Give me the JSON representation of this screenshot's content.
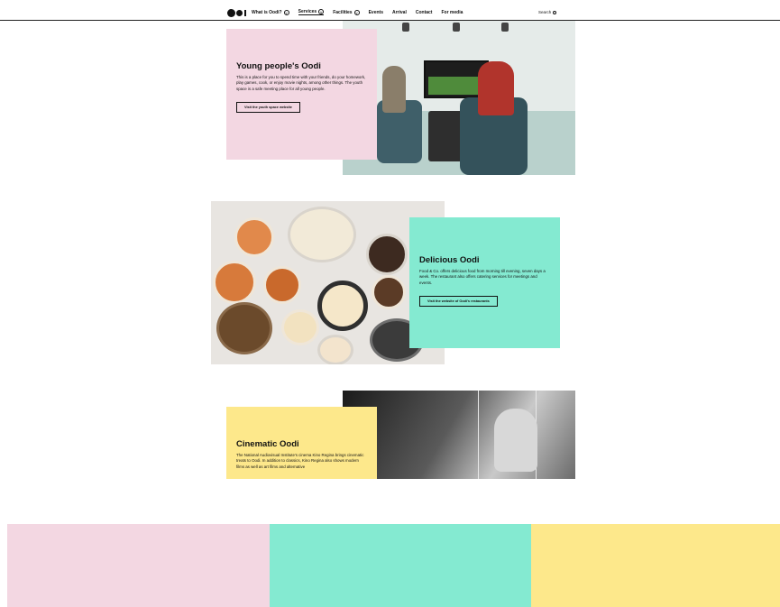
{
  "nav": {
    "items": [
      {
        "label": "What is Oodi?",
        "chevron": true,
        "active": false
      },
      {
        "label": "Services",
        "chevron": true,
        "active": true
      },
      {
        "label": "Facilities",
        "chevron": true,
        "active": false
      },
      {
        "label": "Events",
        "chevron": false,
        "active": false
      },
      {
        "label": "Arrival",
        "chevron": false,
        "active": false
      },
      {
        "label": "Contact",
        "chevron": false,
        "active": false
      },
      {
        "label": "For media",
        "chevron": false,
        "active": false
      }
    ],
    "search_label": "Search",
    "search_icon": "search-icon",
    "logo_icon": "oodi-logo"
  },
  "sections": {
    "youth": {
      "title": "Young people's Oodi",
      "text": "This is a place for you to spend time with your friends, do your homework, play games, cook, or enjoy movie nights, among other things. The youth space is a safe meeting place for all young people.",
      "button": "Visit the youth space website",
      "color": "#f3d7e2"
    },
    "food": {
      "title": "Delicious Oodi",
      "text": "Food & Co. offers delicious food from morning till evening, seven days a week. The restaurant also offers catering services for meetings and events.",
      "button": "Visit the website of Oodi's restaurants",
      "color": "#84ead1"
    },
    "cinema": {
      "title": "Cinematic Oodi",
      "text": "The National Audiovisual Institute's cinema Kino Regina brings cinematic treats to Oodi. In addition to classics, Kino Regina also shows modern films as well as art films and alternative",
      "color": "#fde88b"
    }
  },
  "footer_colors": [
    "#f3d7e2",
    "#84ead1",
    "#fde88b"
  ]
}
